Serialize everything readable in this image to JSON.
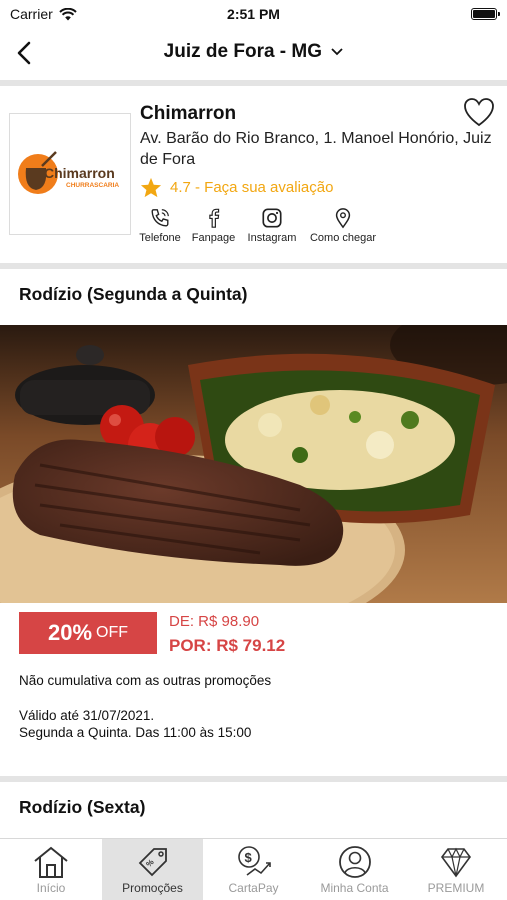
{
  "status_bar": {
    "carrier": "Carrier",
    "time": "2:51 PM"
  },
  "nav": {
    "title": "Juiz de Fora - MG"
  },
  "restaurant": {
    "name": "Chimarron",
    "address": "Av. Barão do Rio Branco, 1. Manoel Honório, Juiz de Fora",
    "rating": "4.7 - Faça sua avaliação",
    "logo_text": "Chimarron",
    "logo_subtext": "CHURRASCARIA",
    "contacts": [
      {
        "label": "Telefone",
        "icon": "phone-icon"
      },
      {
        "label": "Fanpage",
        "icon": "facebook-icon"
      },
      {
        "label": "Instagram",
        "icon": "instagram-icon"
      },
      {
        "label": "Como chegar",
        "icon": "map-pin-icon"
      }
    ]
  },
  "promotions": [
    {
      "title": "Rodízio (Segunda a Quinta)",
      "discount": "20%",
      "discount_suffix": "OFF",
      "old_price": "DE: R$  98.90",
      "new_price": "POR: R$  79.12",
      "note": "Não cumulativa com as outras promoções",
      "validity": "Válido até 31/07/2021.",
      "schedule": "Segunda a Quinta. Das 11:00 às 15:00"
    },
    {
      "title": "Rodízio (Sexta)"
    }
  ],
  "tabs": [
    {
      "label": "Início",
      "icon": "home-icon",
      "active": false
    },
    {
      "label": "Promoções",
      "icon": "price-tag-icon",
      "active": true
    },
    {
      "label": "CartaPay",
      "icon": "dollar-chart-icon",
      "active": false
    },
    {
      "label": "Minha Conta",
      "icon": "user-icon",
      "active": false
    },
    {
      "label": "PREMIUM",
      "icon": "diamond-icon",
      "active": false
    }
  ],
  "colors": {
    "accent_red": "#d64545",
    "rating_gold": "#f2a712",
    "logo_orange": "#f07d1a"
  }
}
